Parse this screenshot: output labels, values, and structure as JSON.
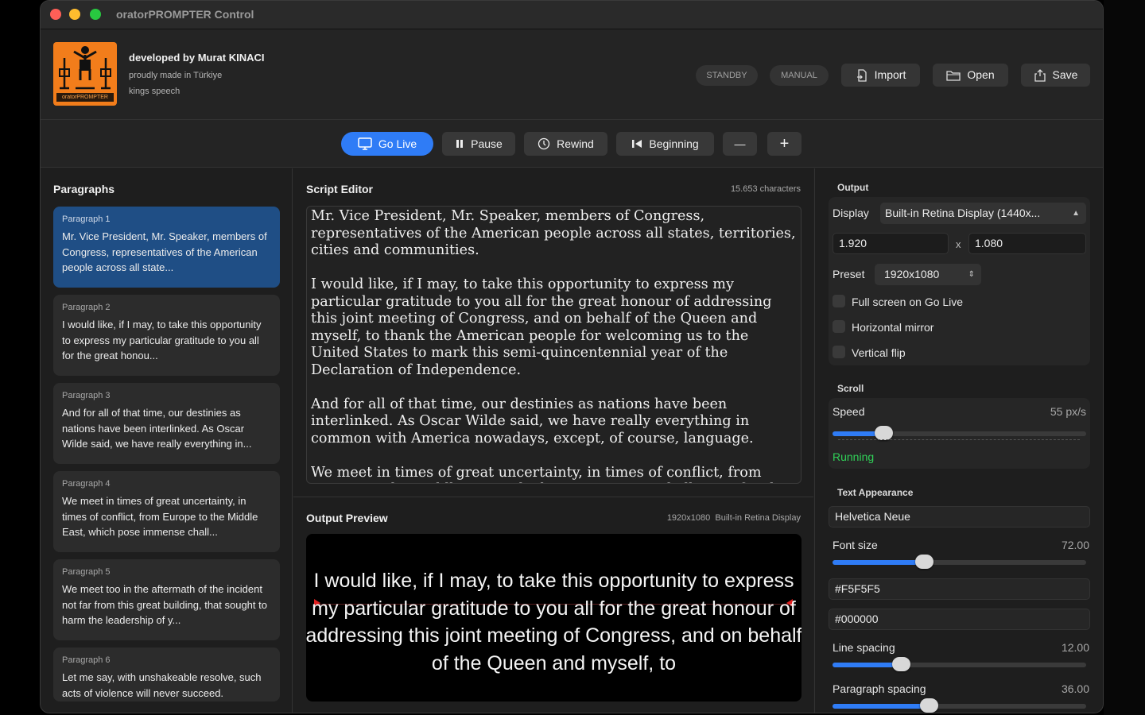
{
  "window": {
    "title": "oratorPROMPTER Control"
  },
  "header": {
    "logo_text": "oratorPROMPTER",
    "developer": "developed by Murat KINACI",
    "made_in": "proudly made in Türkiye",
    "tagline": "kings speech",
    "mode_pills": [
      "STANDBY",
      "MANUAL"
    ],
    "import_label": "Import",
    "open_label": "Open",
    "save_label": "Save"
  },
  "transport": {
    "go_live": "Go Live",
    "pause": "Pause",
    "rewind": "Rewind",
    "beginning": "Beginning",
    "minus": "—",
    "plus": "+"
  },
  "paragraphs": {
    "title": "Paragraphs",
    "items": [
      {
        "label": "Paragraph 1",
        "preview": "Mr. Vice President, Mr. Speaker, members of Congress, representatives of the American people across all state..."
      },
      {
        "label": "Paragraph 2",
        "preview": "I would like, if I may, to take this opportunity to express my particular gratitude to you all for the great honou..."
      },
      {
        "label": "Paragraph 3",
        "preview": "And for all of that time, our destinies as nations have been interlinked. As Oscar Wilde said, we have really everything in..."
      },
      {
        "label": "Paragraph 4",
        "preview": "We meet in times of great uncertainty, in times of conflict, from Europe to the Middle East, which pose immense chall..."
      },
      {
        "label": "Paragraph 5",
        "preview": "We meet too in the aftermath of the incident not far from this great building, that sought to harm the leadership of y..."
      },
      {
        "label": "Paragraph 6",
        "preview": "Let me say, with unshakeable resolve, such acts of violence will never succeed."
      }
    ]
  },
  "editor": {
    "title": "Script Editor",
    "char_count": "15.653 characters",
    "paragraphs": [
      "Mr. Vice President, Mr. Speaker, members of Congress, representatives of the American people across all states, territories, cities and communities.",
      "I would like, if I may, to take this opportunity to express my particular gratitude to you all for the great honour of addressing this joint meeting of Congress, and on behalf of the Queen and myself, to thank the American people for welcoming us to the United States to mark this semi-quincentennial year of the Declaration of Independence.",
      "And for all of that time, our destinies as nations have been interlinked. As Oscar Wilde said, we have really everything in common with America nowadays, except, of course, language.",
      "We meet in times of great uncertainty, in times of conflict, from Europe to the Middle East, which pose immense challenges for the international"
    ]
  },
  "preview": {
    "title": "Output Preview",
    "resolution": "1920x1080",
    "display": "Built-in Retina Display",
    "text": "I would like, if I may, to take this opportunity to express my particular gratitude to you all for the great honour of addressing this joint meeting of Congress, and on behalf of the Queen and myself, to"
  },
  "output": {
    "title": "Output",
    "display_label": "Display",
    "display_value": "Built-in Retina Display (1440x...",
    "width": "1.920",
    "times": "x",
    "height": "1.080",
    "preset_label": "Preset",
    "preset_value": "1920x1080",
    "fullscreen_label": "Full screen on Go Live",
    "fullscreen_checked": false,
    "mirror_label": "Horizontal mirror",
    "mirror_checked": false,
    "flip_label": "Vertical flip",
    "flip_checked": false
  },
  "scroll": {
    "title": "Scroll",
    "speed_label": "Speed",
    "speed_value": "55 px/s",
    "speed_fraction": 0.2,
    "status": "Running"
  },
  "appearance": {
    "title": "Text Appearance",
    "font": "Helvetica Neue",
    "font_size_label": "Font size",
    "font_size_value": "72.00",
    "font_size_fraction": 0.36,
    "text_color": "#F5F5F5",
    "bg_color": "#000000",
    "line_spacing_label": "Line spacing",
    "line_spacing_value": "12.00",
    "line_spacing_fraction": 0.27,
    "paragraph_spacing_label": "Paragraph spacing",
    "paragraph_spacing_value": "36.00",
    "paragraph_spacing_fraction": 0.38
  },
  "colors": {
    "accent": "#2f7cf6",
    "selected_paragraph": "#1f4e85",
    "running": "#30d158",
    "logo_bg": "#f27d1b"
  }
}
